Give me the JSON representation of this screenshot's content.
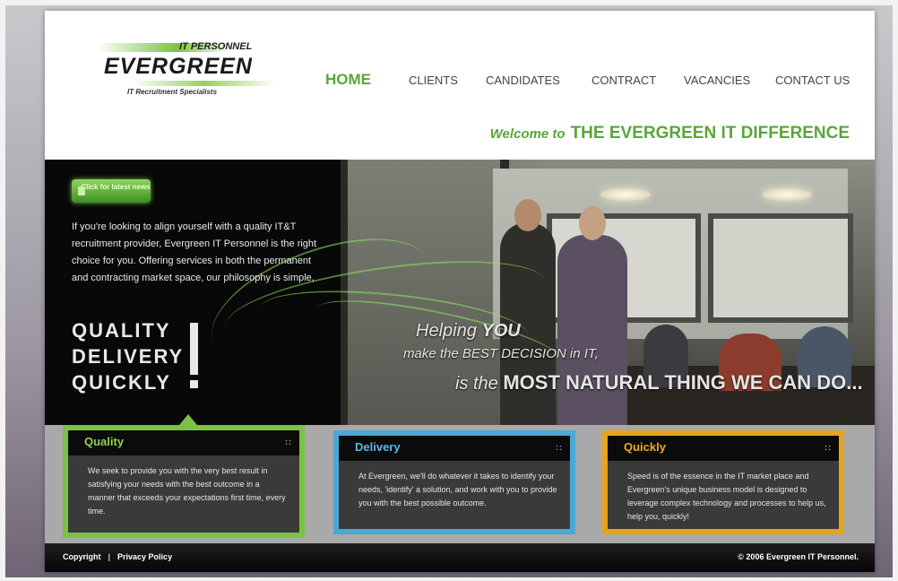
{
  "logo": {
    "top": "IT PERSONNEL",
    "main": "EVERGREEN",
    "sub": "IT Recruitment Specialists"
  },
  "nav": [
    {
      "label": "HOME",
      "active": true
    },
    {
      "label": "CLIENTS"
    },
    {
      "label": "CANDIDATES"
    },
    {
      "label": "CONTRACT"
    },
    {
      "label": "VACANCIES"
    },
    {
      "label": "CONTACT US"
    }
  ],
  "welcome": {
    "prefix": "Welcome to",
    "headline": "THE EVERGREEN IT DIFFERENCE"
  },
  "hero": {
    "news_button": "Click for latest news",
    "intro": "If you're looking to align yourself with a quality IT&T recruitment provider, Evergreen IT Personnel is the right choice for you. Offering services in both the permanent and contracting market space, our philosophy is simple,",
    "qdq": [
      "QUALITY",
      "DELIVERY",
      "QUICKLY"
    ],
    "tag1_a": "Helping ",
    "tag1_b": "YOU",
    "tag2": "make the BEST DECISION in IT,",
    "tag3_a": "is the ",
    "tag3_b": "MOST NATURAL THING WE CAN DO..."
  },
  "features": [
    {
      "title": "Quality",
      "text": "We seek to provide you with the very best result in satisfying your needs with the best outcome in a manner that exceeds your expectations first time, every time.",
      "color": "#7cc242"
    },
    {
      "title": "Delivery",
      "text": "At Evergreen, we'll do whatever it takes to identify your needs, 'identify' a solution, and work with you to provide you with the best possible outcome.",
      "color": "#49a8d6"
    },
    {
      "title": "Quickly",
      "text": "Speed is of the essence in the IT market place and Evergreen's unique business model is designed to leverage complex technology and processes to help us, help you, quickly!",
      "color": "#e8a21e"
    }
  ],
  "footer": {
    "copyright": "Copyright",
    "separator": "|",
    "privacy": "Privacy Policy",
    "right": "© 2006 Evergreen IT Personnel."
  }
}
